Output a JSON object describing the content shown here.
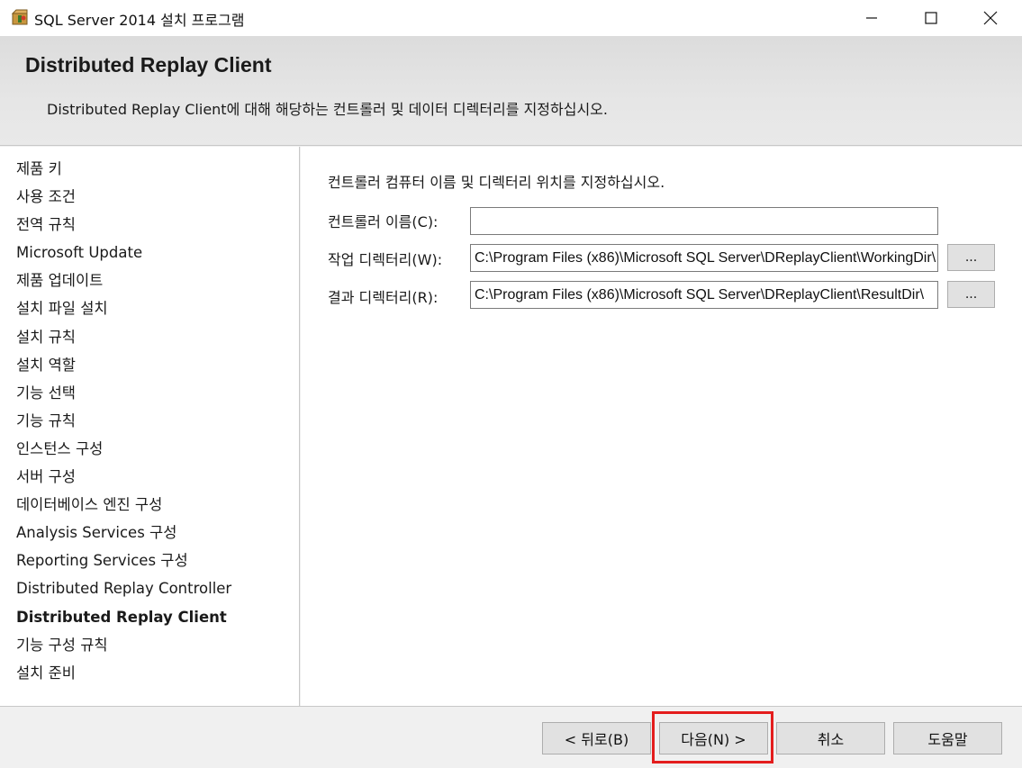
{
  "window": {
    "title": "SQL Server 2014 설치 프로그램",
    "icon": "sql-setup-box-icon",
    "minimize_glyph": "—",
    "maximize_glyph": "☐",
    "close_glyph": "✕"
  },
  "header": {
    "title": "Distributed Replay Client",
    "subtitle": "Distributed  Replay  Client에 대해 해당하는 컨트롤러 및 데이터 디렉터리를 지정하십시오."
  },
  "sidebar": {
    "items": [
      {
        "label": "제품 키"
      },
      {
        "label": "사용 조건"
      },
      {
        "label": "전역 규칙"
      },
      {
        "label": "Microsoft Update"
      },
      {
        "label": "제품 업데이트"
      },
      {
        "label": "설치 파일 설치"
      },
      {
        "label": "설치 규칙"
      },
      {
        "label": "설치 역할"
      },
      {
        "label": "기능 선택"
      },
      {
        "label": "기능 규칙"
      },
      {
        "label": "인스턴스 구성"
      },
      {
        "label": "서버 구성"
      },
      {
        "label": "데이터베이스 엔진 구성"
      },
      {
        "label": "Analysis Services 구성"
      },
      {
        "label": "Reporting Services 구성"
      },
      {
        "label": "Distributed Replay Controller"
      },
      {
        "label": "Distributed Replay Client"
      },
      {
        "label": "기능 구성 규칙"
      },
      {
        "label": "설치 준비"
      }
    ],
    "active_index": 16
  },
  "main": {
    "instruction": "컨트롤러 컴퓨터 이름 및 디렉터리 위치를 지정하십시오.",
    "controller_name": {
      "label": "컨트롤러  이름(C):",
      "value": ""
    },
    "working_dir": {
      "label": "작업  디렉터리(W):",
      "value": "C:\\Program Files (x86)\\Microsoft SQL Server\\DReplayClient\\WorkingDir\\",
      "browse_label": "..."
    },
    "result_dir": {
      "label": "결과  디렉터리(R):",
      "value": "C:\\Program Files (x86)\\Microsoft SQL Server\\DReplayClient\\ResultDir\\",
      "browse_label": "..."
    }
  },
  "footer": {
    "back_label": "< 뒤로(B)",
    "next_label": "다음(N) >",
    "cancel_label": "취소",
    "help_label": "도움말"
  },
  "colors": {
    "highlight": "#e41d1d"
  }
}
